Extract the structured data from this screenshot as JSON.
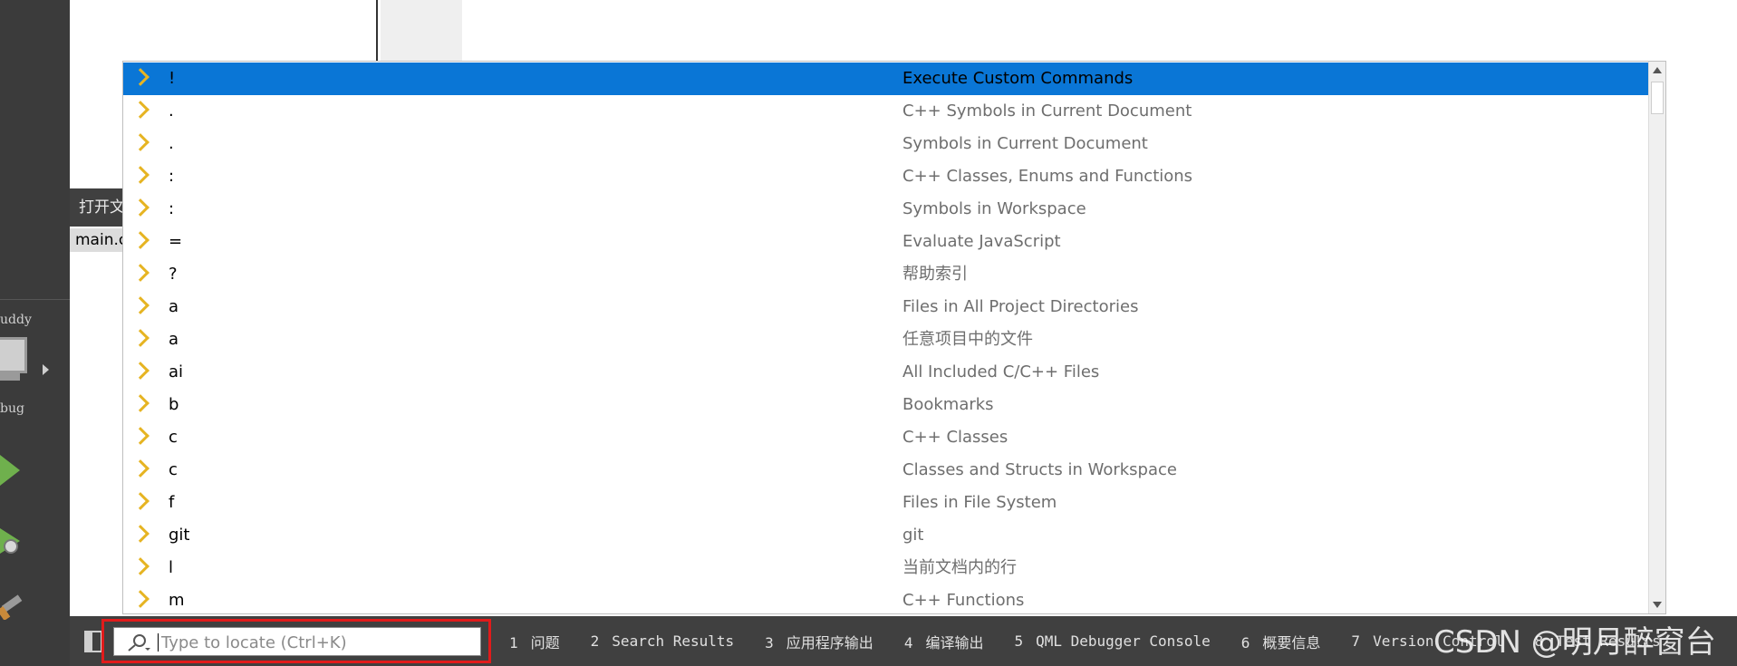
{
  "sidebar": {
    "labels": [
      "uddy",
      "bug"
    ]
  },
  "open_documents": {
    "header": "打开文",
    "item": "main.c"
  },
  "locator_popup": {
    "rows": [
      {
        "prefix": "!",
        "description": "Execute Custom Commands",
        "selected": true
      },
      {
        "prefix": ".",
        "description": "C++ Symbols in Current Document"
      },
      {
        "prefix": ".",
        "description": "Symbols in Current Document"
      },
      {
        "prefix": ":",
        "description": "C++ Classes, Enums and Functions"
      },
      {
        "prefix": ":",
        "description": "Symbols in Workspace"
      },
      {
        "prefix": "=",
        "description": "Evaluate JavaScript"
      },
      {
        "prefix": "?",
        "description": "帮助索引"
      },
      {
        "prefix": "a",
        "description": "Files in All Project Directories"
      },
      {
        "prefix": "a",
        "description": "任意项目中的文件"
      },
      {
        "prefix": "ai",
        "description": "All Included C/C++ Files"
      },
      {
        "prefix": "b",
        "description": "Bookmarks"
      },
      {
        "prefix": "c",
        "description": "C++ Classes"
      },
      {
        "prefix": "c",
        "description": "Classes and Structs in Workspace"
      },
      {
        "prefix": "f",
        "description": "Files in File System"
      },
      {
        "prefix": "git",
        "description": "git"
      },
      {
        "prefix": "l",
        "description": "当前文档内的行"
      },
      {
        "prefix": "m",
        "description": "C++ Functions"
      }
    ]
  },
  "statusbar": {
    "locator_placeholder": "Type to locate (Ctrl+K)",
    "panes": [
      {
        "num": "1",
        "label": "问题"
      },
      {
        "num": "2",
        "label": "Search Results"
      },
      {
        "num": "3",
        "label": "应用程序输出"
      },
      {
        "num": "4",
        "label": "编译输出"
      },
      {
        "num": "5",
        "label": "QML Debugger Console"
      },
      {
        "num": "6",
        "label": "概要信息"
      },
      {
        "num": "7",
        "label": "Version Control"
      },
      {
        "num": "8",
        "label": "Test Results"
      }
    ]
  },
  "watermark": "CSDN @明月醉窗台",
  "colors": {
    "selection": "#0a76d6",
    "chevron": "#e6b422",
    "highlight_box": "#e11b1b"
  }
}
